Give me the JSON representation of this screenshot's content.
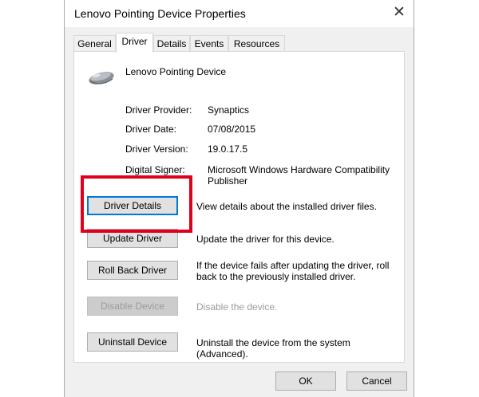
{
  "window": {
    "title": "Lenovo Pointing Device Properties",
    "close_glyph": "✕"
  },
  "tabs": [
    {
      "label": "General"
    },
    {
      "label": "Driver"
    },
    {
      "label": "Details"
    },
    {
      "label": "Events"
    },
    {
      "label": "Resources"
    }
  ],
  "active_tab": "Driver",
  "device": {
    "name": "Lenovo Pointing Device",
    "icon": "mouse-icon"
  },
  "info": {
    "provider_label": "Driver Provider:",
    "provider_value": "Synaptics",
    "date_label": "Driver Date:",
    "date_value": "07/08/2015",
    "version_label": "Driver Version:",
    "version_value": "19.0.17.5",
    "signer_label": "Digital Signer:",
    "signer_value": "Microsoft Windows Hardware Compatibility Publisher"
  },
  "actions": {
    "details_label": "Driver Details",
    "details_desc": "View details about the installed driver files.",
    "update_label": "Update Driver",
    "update_desc": "Update the driver for this device.",
    "rollback_label": "Roll Back Driver",
    "rollback_desc": "If the device fails after updating the driver, roll back to the previously installed driver.",
    "disable_label": "Disable Device",
    "disable_desc": "Disable the device.",
    "uninstall_label": "Uninstall Device",
    "uninstall_desc": "Uninstall the device from the system (Advanced)."
  },
  "footer": {
    "ok_label": "OK",
    "cancel_label": "Cancel"
  },
  "colors": {
    "highlight": "#e0001b",
    "focus": "#0078d7"
  }
}
